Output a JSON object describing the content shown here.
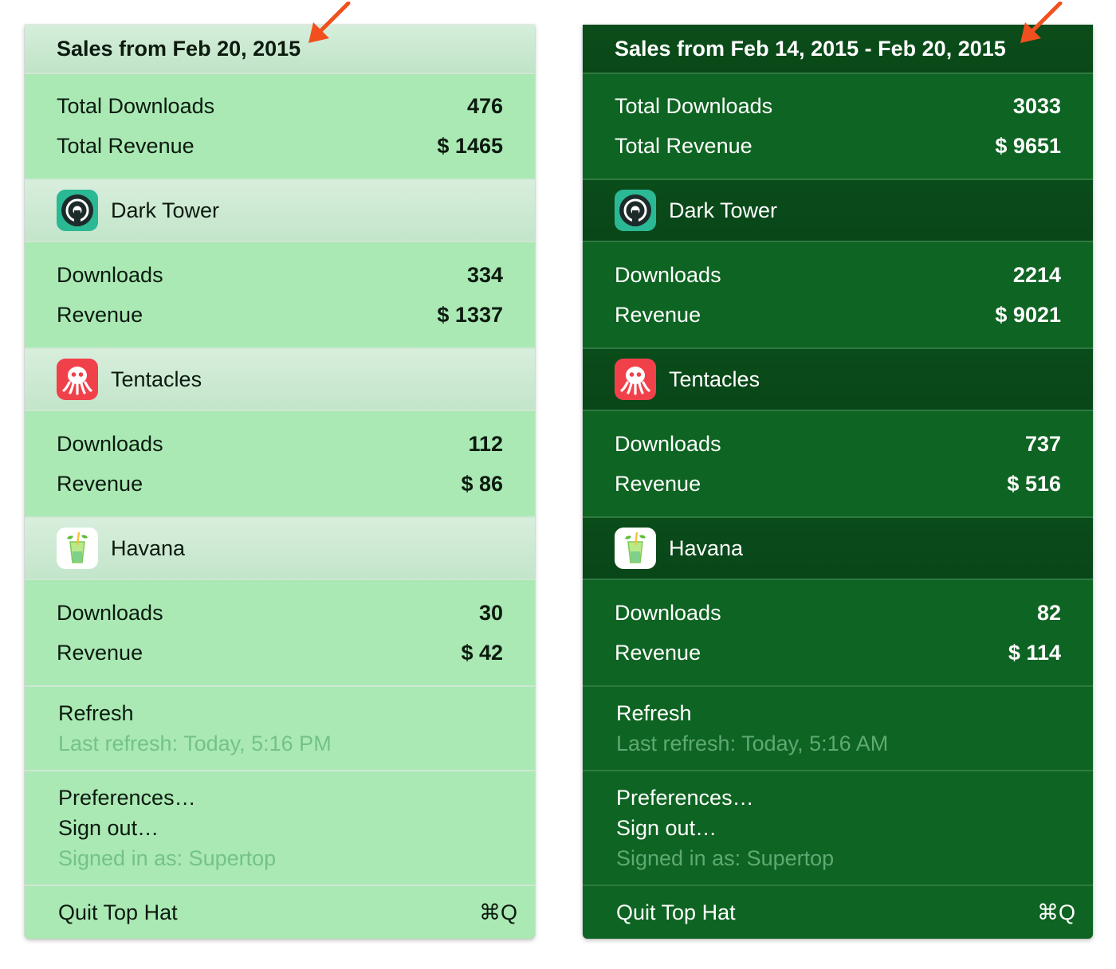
{
  "accent_color": "#f1501e",
  "panels": [
    {
      "theme": "light",
      "header": "Sales from Feb 20, 2015",
      "totals": {
        "downloads_label": "Total Downloads",
        "downloads": "476",
        "revenue_label": "Total Revenue",
        "revenue": "$ 1465"
      },
      "apps": [
        {
          "name": "Dark Tower",
          "icon": "dark-tower-icon",
          "downloads_label": "Downloads",
          "downloads": "334",
          "revenue_label": "Revenue",
          "revenue": "$ 1337"
        },
        {
          "name": "Tentacles",
          "icon": "octopus-icon",
          "downloads_label": "Downloads",
          "downloads": "112",
          "revenue_label": "Revenue",
          "revenue": "$ 86"
        },
        {
          "name": "Havana",
          "icon": "cocktail-icon",
          "downloads_label": "Downloads",
          "downloads": "30",
          "revenue_label": "Revenue",
          "revenue": "$ 42"
        }
      ],
      "refresh": {
        "label": "Refresh",
        "last": "Last refresh: Today, 5:16 PM"
      },
      "account": {
        "preferences": "Preferences…",
        "sign_out": "Sign out…",
        "signed_in": "Signed in as: Supertop"
      },
      "quit": {
        "label": "Quit Top Hat",
        "shortcut": "⌘Q"
      }
    },
    {
      "theme": "dark",
      "header": "Sales from Feb 14, 2015 - Feb 20, 2015",
      "totals": {
        "downloads_label": "Total Downloads",
        "downloads": "3033",
        "revenue_label": "Total Revenue",
        "revenue": "$ 9651"
      },
      "apps": [
        {
          "name": "Dark Tower",
          "icon": "dark-tower-icon",
          "downloads_label": "Downloads",
          "downloads": "2214",
          "revenue_label": "Revenue",
          "revenue": "$ 9021"
        },
        {
          "name": "Tentacles",
          "icon": "octopus-icon",
          "downloads_label": "Downloads",
          "downloads": "737",
          "revenue_label": "Revenue",
          "revenue": "$ 516"
        },
        {
          "name": "Havana",
          "icon": "cocktail-icon",
          "downloads_label": "Downloads",
          "downloads": "82",
          "revenue_label": "Revenue",
          "revenue": "$ 114"
        }
      ],
      "refresh": {
        "label": "Refresh",
        "last": "Last refresh: Today, 5:16 AM"
      },
      "account": {
        "preferences": "Preferences…",
        "sign_out": "Sign out…",
        "signed_in": "Signed in as: Supertop"
      },
      "quit": {
        "label": "Quit Top Hat",
        "shortcut": "⌘Q"
      }
    }
  ]
}
